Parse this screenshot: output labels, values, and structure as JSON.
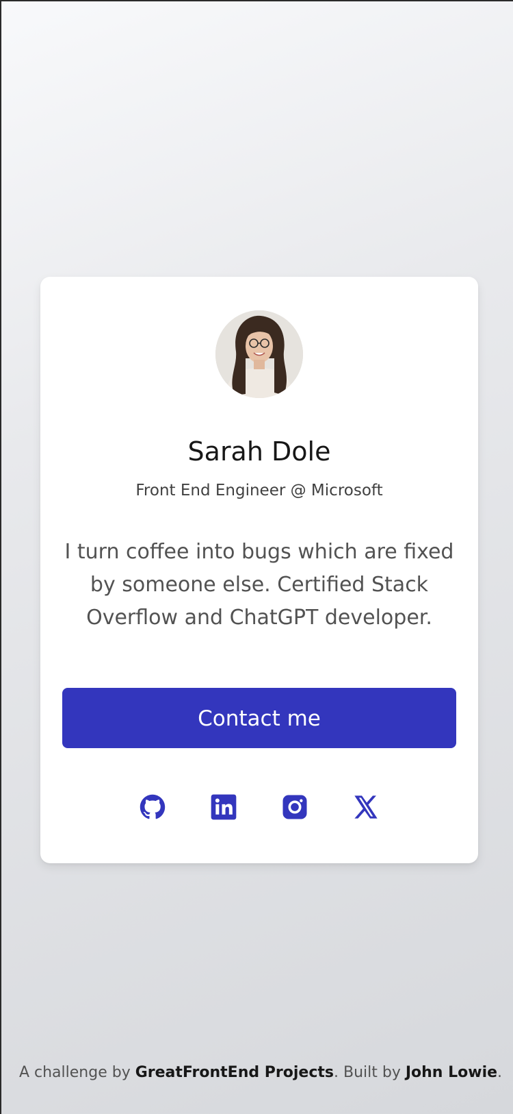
{
  "profile": {
    "name": "Sarah Dole",
    "role": "Front End Engineer @ Microsoft",
    "bio": "I turn coffee into bugs which are fixed by someone else. Certified Stack Overflow and ChatGPT developer."
  },
  "contact": {
    "label": "Contact me"
  },
  "socials": [
    {
      "icon": "github-icon"
    },
    {
      "icon": "linkedin-icon"
    },
    {
      "icon": "instagram-icon"
    },
    {
      "icon": "x-icon"
    }
  ],
  "footer": {
    "prefix": "A challenge by ",
    "challenge_link": "GreatFrontEnd Projects",
    "middle": ". Built by ",
    "author_link": "John Lowie",
    "suffix": "."
  },
  "colors": {
    "accent": "#3336bd",
    "card": "#ffffff",
    "heading": "#171717",
    "body_text": "#525252"
  }
}
